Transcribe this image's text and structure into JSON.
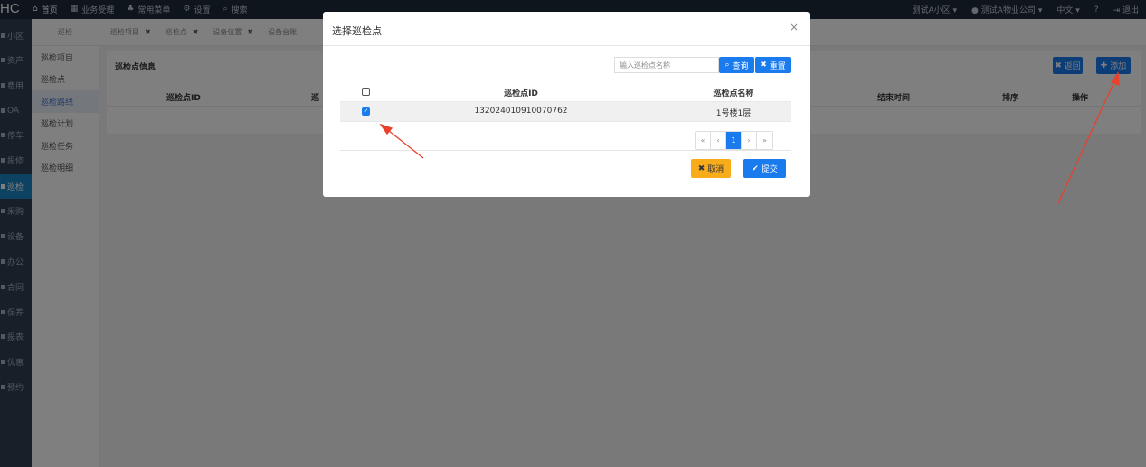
{
  "topbar": {
    "logo": "HC",
    "nav": [
      {
        "icon": "home-icon",
        "glyph": "⌂",
        "label": "首页"
      },
      {
        "icon": "briefcase-icon",
        "glyph": "▦",
        "label": "业务受理"
      },
      {
        "icon": "sitemap-icon",
        "glyph": "♣",
        "label": "常用菜单"
      },
      {
        "icon": "gear-icon",
        "glyph": "⚙",
        "label": "设置"
      },
      {
        "icon": "search-icon",
        "glyph": "⌕",
        "label": "搜索"
      }
    ],
    "community": "测试A小区",
    "company": "测试A物业公司",
    "language": "中文",
    "logout": "退出"
  },
  "sidebar": {
    "items": [
      "小区",
      "资产",
      "费用",
      "OA",
      "停车",
      "报修",
      "巡检",
      "采购",
      "设备",
      "办公",
      "合同",
      "保养",
      "报表",
      "优惠",
      "预约"
    ],
    "active_index": 6
  },
  "submenu": {
    "header": "巡检",
    "items": [
      "巡检项目",
      "巡检点",
      "巡检路线",
      "巡检计划",
      "巡检任务",
      "巡检明细"
    ],
    "active_index": 2
  },
  "tabs": {
    "items": [
      "巡检项目",
      "巡检点",
      "设备位置",
      "设备台账"
    ],
    "close_glyph": "✖"
  },
  "panel": {
    "title": "巡检点信息",
    "back_label": "返回",
    "add_label": "添加",
    "columns": [
      "巡检点ID",
      "巡",
      "结束时间",
      "排序",
      "操作"
    ]
  },
  "modal": {
    "title": "选择巡检点",
    "close_glyph": "×",
    "search_placeholder": "输入巡检点名称",
    "query_label": "查询",
    "reset_label": "重置",
    "columns": [
      "巡检点ID",
      "巡检点名称"
    ],
    "rows": [
      {
        "id": "132024010910070762",
        "name": "1号楼1层",
        "checked": true
      }
    ],
    "pagination": [
      "«",
      "‹",
      "1",
      "›",
      "»"
    ],
    "current_page": "1",
    "cancel_label": "取消",
    "submit_label": "提交"
  },
  "colors": {
    "topbar_bg": "#1c2b3a",
    "sidebar_bg": "#2f4050",
    "primary": "#1a7bef",
    "warning": "#f8ac1a",
    "annotation_arrow": "#e8412c"
  }
}
